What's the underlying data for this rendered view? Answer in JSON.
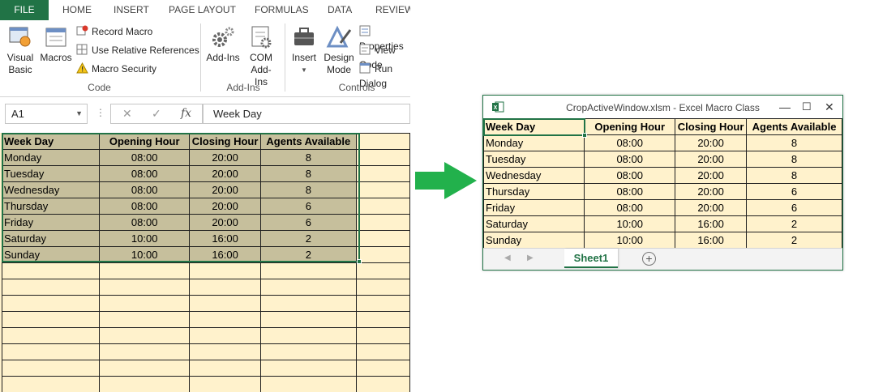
{
  "ribbon": {
    "tabs": [
      "FILE",
      "HOME",
      "INSERT",
      "PAGE LAYOUT",
      "FORMULAS",
      "DATA",
      "REVIEW"
    ],
    "code_group": {
      "visual_basic": "Visual Basic",
      "macros": "Macros",
      "record_macro": "Record Macro",
      "use_relative_references": "Use Relative References",
      "macro_security": "Macro Security",
      "label": "Code"
    },
    "addins_group": {
      "add_ins": "Add-Ins",
      "com_add_ins": "COM Add-Ins",
      "label": "Add-Ins"
    },
    "controls_group": {
      "insert": "Insert",
      "design_mode": "Design Mode",
      "properties": "Properties",
      "view_code": "View Code",
      "run_dialog": "Run Dialog",
      "label": "Controls"
    }
  },
  "formula_bar": {
    "name_box": "A1",
    "value": "Week Day"
  },
  "table": {
    "headers": [
      "Week Day",
      "Opening Hour",
      "Closing Hour",
      "Agents Available"
    ],
    "rows": [
      [
        "Monday",
        "08:00",
        "20:00",
        "8"
      ],
      [
        "Tuesday",
        "08:00",
        "20:00",
        "8"
      ],
      [
        "Wednesday",
        "08:00",
        "20:00",
        "8"
      ],
      [
        "Thursday",
        "08:00",
        "20:00",
        "6"
      ],
      [
        "Friday",
        "08:00",
        "20:00",
        "6"
      ],
      [
        "Saturday",
        "10:00",
        "16:00",
        "2"
      ],
      [
        "Sunday",
        "10:00",
        "16:00",
        "2"
      ]
    ]
  },
  "window": {
    "title": "CropActiveWindow.xlsm - Excel Macro Class",
    "sheet_tab": "Sheet1"
  },
  "colors": {
    "excel_green": "#217346",
    "cell_fill": "#fff2cc",
    "selected_fill": "#c6bf9c",
    "arrow_green": "#22b14c"
  }
}
